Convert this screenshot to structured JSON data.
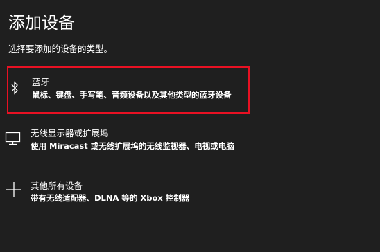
{
  "header": {
    "title": "添加设备",
    "subtitle": "选择要添加的设备的类型。"
  },
  "options": [
    {
      "icon": "bluetooth-icon",
      "title": "蓝牙",
      "description": "鼠标、键盘、手写笔、音频设备以及其他类型的蓝牙设备",
      "selected": true
    },
    {
      "icon": "monitor-icon",
      "title": "无线显示器或扩展坞",
      "description": "使用 Miracast 或无线扩展坞的无线监视器、电视或电脑",
      "selected": false
    },
    {
      "icon": "plus-icon",
      "title": "其他所有设备",
      "description": "带有无线适配器、DLNA 等的 Xbox 控制器",
      "selected": false
    }
  ],
  "colors": {
    "background": "#1f1f1f",
    "text": "#ffffff",
    "selection_border": "#e81123"
  }
}
